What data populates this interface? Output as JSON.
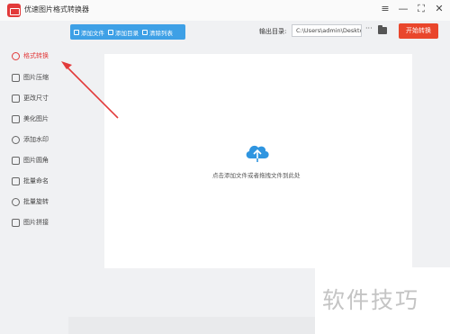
{
  "titlebar": {
    "title": "优速图片格式转换器",
    "controls": [
      "≡",
      "—",
      "⛶",
      "✕"
    ]
  },
  "toolbar": {
    "add_file": "添加文件",
    "add_folder": "添加目录",
    "clear_list": "清除列表",
    "output_label": "输出目录:",
    "output_path": "C:\\Users\\admin\\Deskto",
    "more": "···",
    "start": "开始转换"
  },
  "sidebar": {
    "items": [
      {
        "label": "格式转换",
        "icon": "format-convert-icon",
        "active": true
      },
      {
        "label": "图片压缩",
        "icon": "compress-icon",
        "active": false
      },
      {
        "label": "更改尺寸",
        "icon": "resize-icon",
        "active": false
      },
      {
        "label": "美化图片",
        "icon": "beautify-icon",
        "active": false
      },
      {
        "label": "添加水印",
        "icon": "watermark-icon",
        "active": false
      },
      {
        "label": "图片圆角",
        "icon": "rounded-corner-icon",
        "active": false
      },
      {
        "label": "批量命名",
        "icon": "rename-icon",
        "active": false
      },
      {
        "label": "批量旋转",
        "icon": "rotate-icon",
        "active": false
      },
      {
        "label": "图片拼接",
        "icon": "stitch-icon",
        "active": false
      }
    ]
  },
  "main": {
    "drop_hint": "点击添加文件或者拖拽文件到此处",
    "upload_icon": "cloud-upload-icon"
  },
  "watermark": "软件技巧",
  "colors": {
    "accent_blue": "#3ea0e6",
    "start_red": "#e9462c",
    "highlight_red": "#e23a3a",
    "cloud_blue": "#2f95e0"
  }
}
